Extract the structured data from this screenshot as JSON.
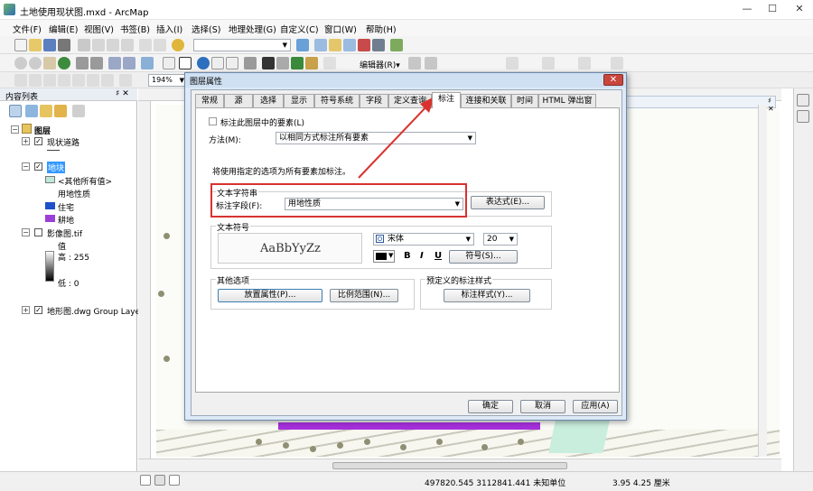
{
  "window": {
    "title": "土地使用现状图.mxd - ArcMap",
    "minimize": "—",
    "maximize": "☐",
    "close": "✕"
  },
  "menu": [
    "文件(F)",
    "编辑(E)",
    "视图(V)",
    "书签(B)",
    "插入(I)",
    "选择(S)",
    "地理处理(G)",
    "自定义(C)",
    "窗口(W)",
    "帮助(H)"
  ],
  "toolbar": {
    "zoom_value": "194%",
    "editor_label": "编辑器(R)▾"
  },
  "toc": {
    "title": "内容列表",
    "pin": "♯ ✕",
    "layers_root": "图层",
    "items": [
      {
        "label": "现状道路"
      },
      {
        "label": "地块",
        "sub": [
          "<其他所有值>",
          "用地性质",
          "住宅",
          "耕地"
        ]
      },
      {
        "label": "影像图.tif",
        "sub": [
          "值",
          "高 : 255",
          "低 : 0"
        ]
      },
      {
        "label": "地形图.dwg Group Laye"
      }
    ],
    "colors": {
      "other": "#bfe8dc",
      "residential": "#1f4fc9",
      "farmland": "#9b3fd8"
    }
  },
  "dialog": {
    "title": "图层属性",
    "close": "✕",
    "tabs": [
      "常规",
      "源",
      "选择",
      "显示",
      "符号系统",
      "字段",
      "定义查询",
      "标注",
      "连接和关联",
      "时间",
      "HTML 弹出窗口"
    ],
    "active_tab": "标注",
    "label_check": "标注此图层中的要素(L)",
    "method_label": "方法(M):",
    "method_value": "以相同方式标注所有要素",
    "info_text": "将使用指定的选项为所有要素加标注。",
    "text_string_group": "文本字符串",
    "label_field_label": "标注字段(F):",
    "label_field_value": "用地性质",
    "expression_button": "表达式(E)...",
    "text_symbol_group": "文本符号",
    "preview_text": "AaBbYyZz",
    "font_name": "宋体",
    "font_size": "20",
    "bold": "B",
    "italic": "I",
    "underline": "U",
    "symbol_button": "符号(S)...",
    "other_options_group": "其他选项",
    "placement_button": "放置属性(P)...",
    "scale_range_button": "比例范围(N)...",
    "predefined_group": "预定义的标注样式",
    "label_styles_button": "标注样式(Y)...",
    "ok": "确定",
    "cancel": "取消",
    "apply": "应用(A)"
  },
  "statusbar": {
    "coords": "497820.545  3112841.441 未知单位",
    "size": "3.95  4.25 厘米"
  },
  "accent_colors": {
    "highlight_box": "#d9322f",
    "arrow": "#d9322f"
  }
}
